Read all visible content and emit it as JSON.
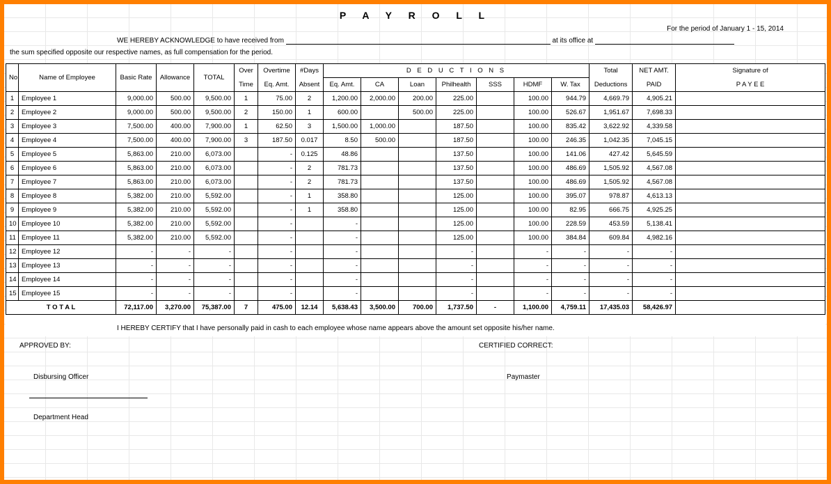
{
  "title": "P A Y R O L L",
  "period_label": "For the period of",
  "period_value": "January 1 - 15,  2014",
  "ack_pre": "WE HEREBY ACKNOWLEDGE to have received from",
  "ack_mid": "at its office at",
  "sum_text": "the sum specified opposite our respective names, as full compensation for the period.",
  "headers": {
    "no": "No.",
    "name": "Name of Employee",
    "basic": "Basic Rate",
    "allowance": "Allowance",
    "total": "TOTAL",
    "over": "Over",
    "time": "Time",
    "overtime": "Overtime",
    "eq_amt": "Eq. Amt.",
    "days": "#Days",
    "absent": "Absent",
    "deductions": "D  E  D  U  C  T  I  O  N  S",
    "ca": "CA",
    "loan": "Loan",
    "philhealth": "Philhealth",
    "sss": "SSS",
    "hdmf": "HDMF",
    "wtax": "W. Tax",
    "total_ded": "Total",
    "deductions_sub": "Deductions",
    "net_amt": "NET AMT.",
    "paid": "PAID",
    "signature": "Signature of",
    "payee": "P A Y E E"
  },
  "rows": [
    {
      "no": "1",
      "name": "Employee 1",
      "basic": "9,000.00",
      "allow": "500.00",
      "total": "9,500.00",
      "ot": "1",
      "oteq": "75.00",
      "abs": "2",
      "dedeq": "1,200.00",
      "ca": "2,000.00",
      "loan": "200.00",
      "phil": "225.00",
      "sss": "",
      "hdmf": "100.00",
      "wtax": "944.79",
      "tded": "4,669.79",
      "net": "4,905.21"
    },
    {
      "no": "2",
      "name": "Employee 2",
      "basic": "9,000.00",
      "allow": "500.00",
      "total": "9,500.00",
      "ot": "2",
      "oteq": "150.00",
      "abs": "1",
      "dedeq": "600.00",
      "ca": "",
      "loan": "500.00",
      "phil": "225.00",
      "sss": "",
      "hdmf": "100.00",
      "wtax": "526.67",
      "tded": "1,951.67",
      "net": "7,698.33"
    },
    {
      "no": "3",
      "name": "Employee 3",
      "basic": "7,500.00",
      "allow": "400.00",
      "total": "7,900.00",
      "ot": "1",
      "oteq": "62.50",
      "abs": "3",
      "dedeq": "1,500.00",
      "ca": "1,000.00",
      "loan": "",
      "phil": "187.50",
      "sss": "",
      "hdmf": "100.00",
      "wtax": "835.42",
      "tded": "3,622.92",
      "net": "4,339.58"
    },
    {
      "no": "4",
      "name": "Employee 4",
      "basic": "7,500.00",
      "allow": "400.00",
      "total": "7,900.00",
      "ot": "3",
      "oteq": "187.50",
      "abs": "0.017",
      "dedeq": "8.50",
      "ca": "500.00",
      "loan": "",
      "phil": "187.50",
      "sss": "",
      "hdmf": "100.00",
      "wtax": "246.35",
      "tded": "1,042.35",
      "net": "7,045.15"
    },
    {
      "no": "5",
      "name": "Employee 5",
      "basic": "5,863.00",
      "allow": "210.00",
      "total": "6,073.00",
      "ot": "",
      "oteq": "-",
      "abs": "0.125",
      "dedeq": "48.86",
      "ca": "",
      "loan": "",
      "phil": "137.50",
      "sss": "",
      "hdmf": "100.00",
      "wtax": "141.06",
      "tded": "427.42",
      "net": "5,645.59"
    },
    {
      "no": "6",
      "name": "Employee 6",
      "basic": "5,863.00",
      "allow": "210.00",
      "total": "6,073.00",
      "ot": "",
      "oteq": "-",
      "abs": "2",
      "dedeq": "781.73",
      "ca": "",
      "loan": "",
      "phil": "137.50",
      "sss": "",
      "hdmf": "100.00",
      "wtax": "486.69",
      "tded": "1,505.92",
      "net": "4,567.08"
    },
    {
      "no": "7",
      "name": "Employee 7",
      "basic": "5,863.00",
      "allow": "210.00",
      "total": "6,073.00",
      "ot": "",
      "oteq": "-",
      "abs": "2",
      "dedeq": "781.73",
      "ca": "",
      "loan": "",
      "phil": "137.50",
      "sss": "",
      "hdmf": "100.00",
      "wtax": "486.69",
      "tded": "1,505.92",
      "net": "4,567.08"
    },
    {
      "no": "8",
      "name": "Employee 8",
      "basic": "5,382.00",
      "allow": "210.00",
      "total": "5,592.00",
      "ot": "",
      "oteq": "-",
      "abs": "1",
      "dedeq": "358.80",
      "ca": "",
      "loan": "",
      "phil": "125.00",
      "sss": "",
      "hdmf": "100.00",
      "wtax": "395.07",
      "tded": "978.87",
      "net": "4,613.13"
    },
    {
      "no": "9",
      "name": "Employee 9",
      "basic": "5,382.00",
      "allow": "210.00",
      "total": "5,592.00",
      "ot": "",
      "oteq": "-",
      "abs": "1",
      "dedeq": "358.80",
      "ca": "",
      "loan": "",
      "phil": "125.00",
      "sss": "",
      "hdmf": "100.00",
      "wtax": "82.95",
      "tded": "666.75",
      "net": "4,925.25"
    },
    {
      "no": "10",
      "name": "Employee 10",
      "basic": "5,382.00",
      "allow": "210.00",
      "total": "5,592.00",
      "ot": "",
      "oteq": "-",
      "abs": "",
      "dedeq": "-",
      "ca": "",
      "loan": "",
      "phil": "125.00",
      "sss": "",
      "hdmf": "100.00",
      "wtax": "228.59",
      "tded": "453.59",
      "net": "5,138.41"
    },
    {
      "no": "11",
      "name": "Employee 11",
      "basic": "5,382.00",
      "allow": "210.00",
      "total": "5,592.00",
      "ot": "",
      "oteq": "-",
      "abs": "",
      "dedeq": "-",
      "ca": "",
      "loan": "",
      "phil": "125.00",
      "sss": "",
      "hdmf": "100.00",
      "wtax": "384.84",
      "tded": "609.84",
      "net": "4,982.16"
    },
    {
      "no": "12",
      "name": "Employee 12",
      "basic": "-",
      "allow": "-",
      "total": "-",
      "ot": "",
      "oteq": "-",
      "abs": "",
      "dedeq": "-",
      "ca": "",
      "loan": "",
      "phil": "-",
      "sss": "",
      "hdmf": "-",
      "wtax": "-",
      "tded": "-",
      "net": "-"
    },
    {
      "no": "13",
      "name": "Employee 13",
      "basic": "-",
      "allow": "-",
      "total": "-",
      "ot": "",
      "oteq": "-",
      "abs": "",
      "dedeq": "-",
      "ca": "",
      "loan": "",
      "phil": "-",
      "sss": "",
      "hdmf": "-",
      "wtax": "-",
      "tded": "-",
      "net": "-"
    },
    {
      "no": "14",
      "name": "Employee 14",
      "basic": "-",
      "allow": "-",
      "total": "-",
      "ot": "",
      "oteq": "-",
      "abs": "",
      "dedeq": "-",
      "ca": "",
      "loan": "",
      "phil": "-",
      "sss": "",
      "hdmf": "-",
      "wtax": "-",
      "tded": "-",
      "net": "-"
    },
    {
      "no": "15",
      "name": "Employee 15",
      "basic": "-",
      "allow": "-",
      "total": "-",
      "ot": "",
      "oteq": "-",
      "abs": "",
      "dedeq": "-",
      "ca": "",
      "loan": "",
      "phil": "-",
      "sss": "",
      "hdmf": "-",
      "wtax": "-",
      "tded": "-",
      "net": "-"
    }
  ],
  "totals": {
    "label": "T O T A L",
    "basic": "72,117.00",
    "allow": "3,270.00",
    "total": "75,387.00",
    "ot": "7",
    "oteq": "475.00",
    "abs": "12.14",
    "dedeq": "5,638.43",
    "ca": "3,500.00",
    "loan": "700.00",
    "phil": "1,737.50",
    "sss": "-",
    "hdmf": "1,100.00",
    "wtax": "4,759.11",
    "tded": "17,435.03",
    "net": "58,426.97"
  },
  "certify": "I HEREBY CERTIFY  that I have personally paid in cash to each employee whose name appears above the amount set opposite his/her name.",
  "approved_by": "APPROVED BY:",
  "certified_correct": "CERTIFIED CORRECT:",
  "disbursing": "Disbursing Officer",
  "paymaster": "Paymaster",
  "dept_head": "Department Head"
}
